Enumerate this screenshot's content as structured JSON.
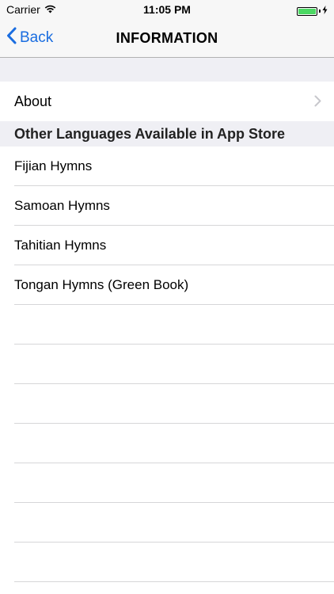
{
  "status_bar": {
    "carrier": "Carrier",
    "time": "11:05 PM",
    "battery_level": 1.0,
    "charging": true
  },
  "nav": {
    "back_label": "Back",
    "title": "INFORMATION"
  },
  "about": {
    "label": "About"
  },
  "section": {
    "header": "Other Languages Available in App Store",
    "items": [
      {
        "label": "Fijian Hymns"
      },
      {
        "label": "Samoan Hymns"
      },
      {
        "label": "Tahitian Hymns"
      },
      {
        "label": "Tongan Hymns (Green Book)"
      }
    ]
  },
  "colors": {
    "accent": "#1a6de0",
    "battery": "#4cd964",
    "group_background": "#efeff4",
    "separator": "#d6d6d8"
  }
}
